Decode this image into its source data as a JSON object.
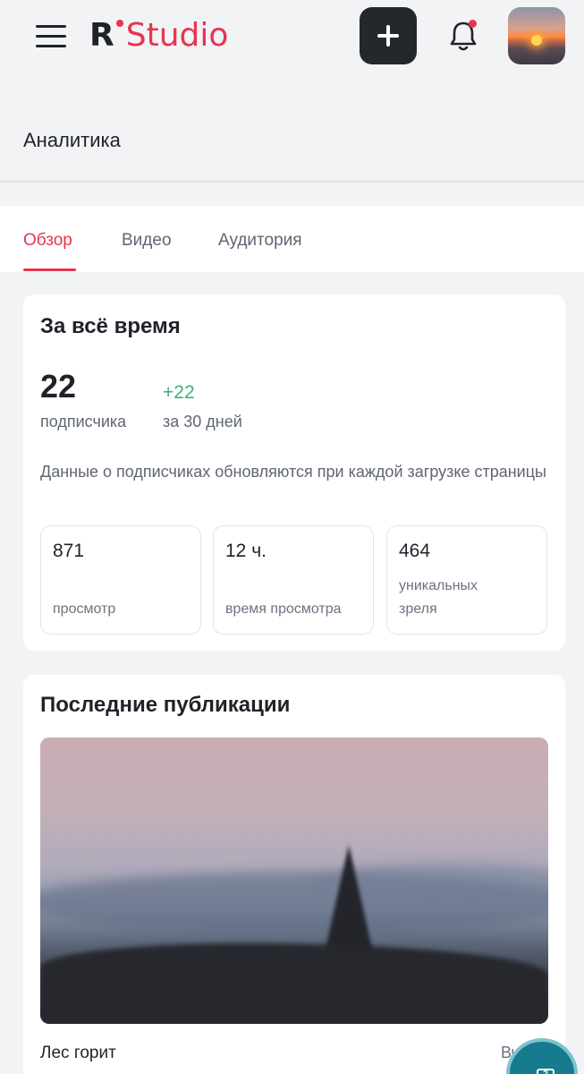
{
  "header": {
    "logo_letter": "R",
    "logo_word": "Studio",
    "avatar_icon": "sunset-avatar",
    "menu_icon": "hamburger-menu-icon",
    "add_icon": "plus-icon",
    "notification_icon": "bell-icon",
    "has_unread_notifications": true
  },
  "page": {
    "title": "Аналитика"
  },
  "tabs": [
    {
      "label": "Обзор",
      "active": true
    },
    {
      "label": "Видео",
      "active": false
    },
    {
      "label": "Аудитория",
      "active": false
    }
  ],
  "overview": {
    "title": "За всё время",
    "subscribers_count": "22",
    "subscribers_label": "подписчика",
    "delta": "+22",
    "delta_label": "за 30 дней",
    "note": "Данные о подписчиках обновляются при каждой загрузке страницы",
    "stats": [
      {
        "value": "871",
        "label": "просмотр"
      },
      {
        "value": "12 ч.",
        "label": "время просмотра"
      },
      {
        "value": "464",
        "label": "уникальных зреля"
      }
    ]
  },
  "latest": {
    "title": "Последние публикации",
    "publication_title": "Лес горит",
    "publication_date": "Вче"
  },
  "colors": {
    "accent": "#e8344e",
    "positive": "#3bb27a",
    "dark_button": "#24272c",
    "background": "#f2f3f5"
  }
}
